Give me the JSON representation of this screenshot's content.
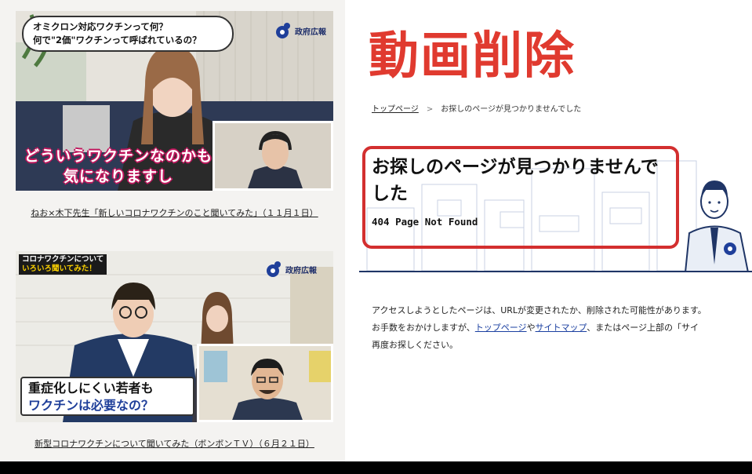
{
  "left_panel": {
    "video1": {
      "bubble_line1": "オミクロン対応ワクチンって何？",
      "bubble_line2": "何で\"2価\"ワクチンって呼ばれているの？",
      "gov_label": "政府広報",
      "subtitle_line1": "どういうワクチンなのかも",
      "subtitle_line2": "気になりますし",
      "caption": "ねお×木下先生「新しいコロナワクチンのこと聞いてみた」（１１月１日）"
    },
    "video2": {
      "corner_line1": "コロナワクチンについて",
      "corner_line2": "いろいろ聞いてみた！",
      "gov_label": "政府広報",
      "subtitle_line1": "重症化しにくい若者も",
      "subtitle_line2": "ワクチンは必要なの？",
      "caption": "新型コロナワクチンについて聞いてみた（ボンボンＴＶ）（６月２１日）"
    }
  },
  "right_panel": {
    "overlay_title": "動画削除",
    "breadcrumb": {
      "home_link": "トップページ",
      "separator": ">",
      "current": "お探しのページが見つかりませんでした"
    },
    "error_title": "お探しのページが見つかりませんでした",
    "error_code": "404 Page Not Found",
    "message": {
      "line1": "アクセスしようとしたページは、URLが変更されたか、削除された可能性があります。",
      "line2_prefix": "お手数をおかけしますが、",
      "line2_link1": "トップページ",
      "line2_mid": "や",
      "line2_link2": "サイトマップ",
      "line2_suffix": "、またはページ上部の「サイ",
      "line3": "再度お探しください。"
    }
  },
  "colors": {
    "accent_red": "#e03a2f",
    "box_red": "#d32f2f",
    "navy": "#1f3566",
    "link_blue": "#1a3fa0"
  }
}
